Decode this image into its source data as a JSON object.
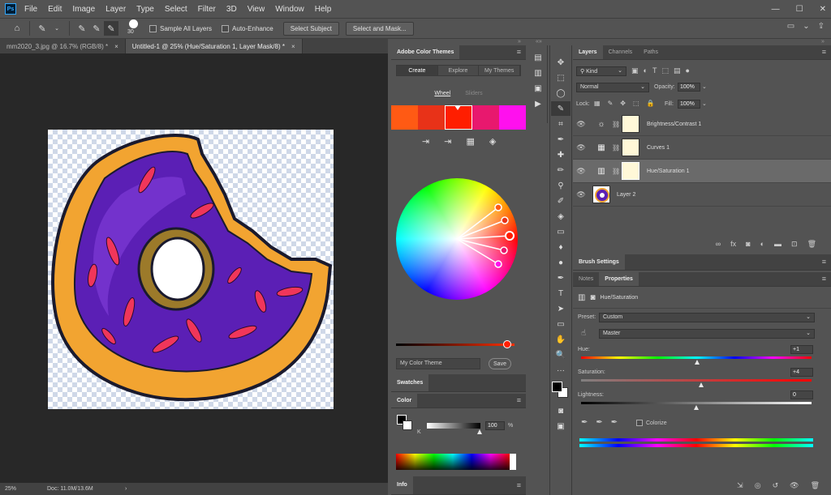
{
  "app": {
    "logo": "Ps",
    "menus": [
      "File",
      "Edit",
      "Image",
      "Layer",
      "Type",
      "Select",
      "Filter",
      "3D",
      "View",
      "Window",
      "Help"
    ],
    "window_controls": {
      "minimize": "—",
      "maximize": "☐",
      "close": "✕"
    }
  },
  "options_bar": {
    "brush_size": "30",
    "sample_all_layers": "Sample All Layers",
    "auto_enhance": "Auto-Enhance",
    "select_subject": "Select Subject",
    "select_and_mask": "Select and Mask..."
  },
  "doc_tabs": [
    {
      "label": "mm2020_3.jpg @ 16.7% (RGB/8) *",
      "close": "×"
    },
    {
      "label": "Untitled-1 @ 25% (Hue/Saturation 1, Layer Mask/8) *",
      "close": "×"
    }
  ],
  "status_bar": {
    "zoom": "25%",
    "doc": "Doc: 11.0M/13.6M",
    "arrow": "›"
  },
  "color_themes": {
    "title": "Adobe Color Themes",
    "tabs": [
      "Create",
      "Explore",
      "My Themes"
    ],
    "subtabs": {
      "wheel": "Wheel",
      "sliders": "Sliders"
    },
    "swatches": [
      "#ff5a14",
      "#e83218",
      "#ff1e00",
      "#e8186e",
      "#ff10ee"
    ],
    "theme_name_placeholder": "My Color Theme",
    "save": "Save"
  },
  "swatches_panel": {
    "title": "Swatches"
  },
  "color_panel": {
    "title": "Color",
    "k_label": "K",
    "k_value": "100",
    "unit": "%"
  },
  "info_panel": {
    "title": "Info"
  },
  "layers_panel": {
    "tabs": [
      "Layers",
      "Channels",
      "Paths"
    ],
    "filter_kind": "Kind",
    "blend_mode": "Normal",
    "opacity_label": "Opacity:",
    "opacity_value": "100%",
    "lock_label": "Lock:",
    "fill_label": "Fill:",
    "fill_value": "100%",
    "layers": [
      {
        "name": "Brightness/Contrast 1",
        "icon": "☼"
      },
      {
        "name": "Curves 1",
        "icon": "▦"
      },
      {
        "name": "Hue/Saturation 1",
        "icon": "▥"
      },
      {
        "name": "Layer 2",
        "icon": ""
      }
    ],
    "footer_icons": [
      "∞",
      "fx",
      "◙",
      "◐",
      "▬",
      "⊡",
      "🗑"
    ]
  },
  "brush_settings": {
    "title": "Brush Settings"
  },
  "properties": {
    "tabs": [
      "Notes",
      "Properties"
    ],
    "adjustment_name": "Hue/Saturation",
    "preset_label": "Preset:",
    "preset_value": "Custom",
    "channel_value": "Master",
    "hue_label": "Hue:",
    "hue_value": "+1",
    "saturation_label": "Saturation:",
    "saturation_value": "+4",
    "lightness_label": "Lightness:",
    "lightness_value": "0",
    "colorize_label": "Colorize"
  }
}
